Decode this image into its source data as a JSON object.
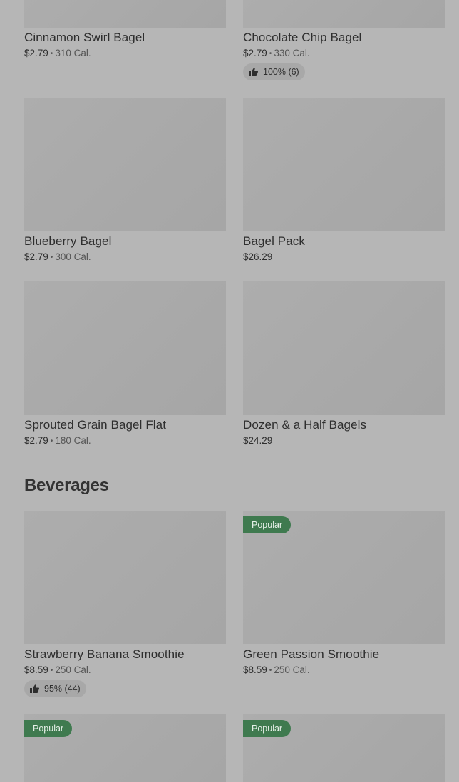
{
  "items": [
    {
      "name": "Cinnamon Swirl Bagel",
      "price": "$2.79",
      "calories": "310 Cal."
    },
    {
      "name": "Chocolate Chip Bagel",
      "price": "$2.79",
      "calories": "330 Cal.",
      "rating": "100% (6)"
    },
    {
      "name": "Blueberry Bagel",
      "price": "$2.79",
      "calories": "300 Cal."
    },
    {
      "name": "Bagel Pack",
      "price": "$26.29"
    },
    {
      "name": "Sprouted Grain Bagel Flat",
      "price": "$2.79",
      "calories": "180 Cal."
    },
    {
      "name": "Dozen & a Half Bagels",
      "price": "$24.29"
    }
  ],
  "sections": {
    "beverages": {
      "title": "Beverages",
      "items": [
        {
          "name": "Strawberry Banana Smoothie",
          "price": "$8.59",
          "calories": "250 Cal.",
          "rating": "95% (44)"
        },
        {
          "name": "Green Passion Smoothie",
          "price": "$8.59",
          "calories": "250 Cal.",
          "badge": "Popular"
        },
        {
          "badge": "Popular"
        },
        {
          "badge": "Popular"
        }
      ]
    }
  },
  "separator": "•",
  "colors": {
    "background": "#b6b6b6",
    "image_placeholder": "#aaaaaa",
    "popular_badge": "#3f7a4f",
    "text": "#2e2e2e"
  },
  "icons": {
    "rating": "thumbs-up-icon"
  }
}
